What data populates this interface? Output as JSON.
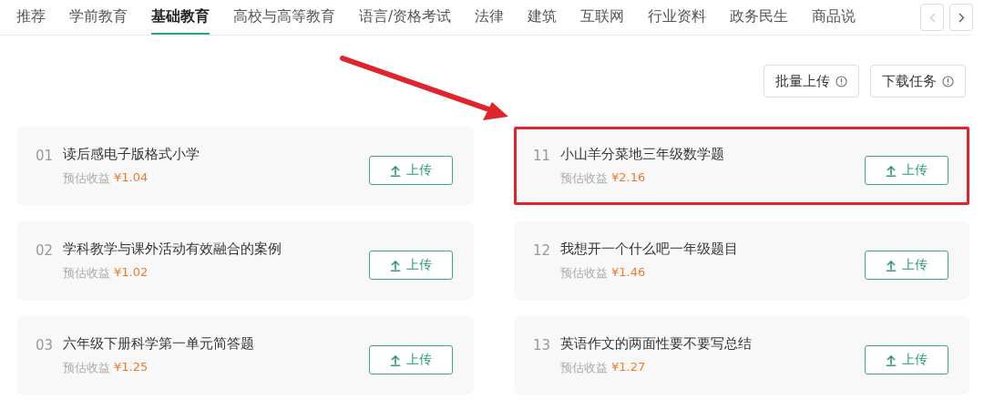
{
  "tabs": [
    {
      "label": "推荐",
      "selected": false
    },
    {
      "label": "学前教育",
      "selected": false
    },
    {
      "label": "基础教育",
      "selected": true
    },
    {
      "label": "高校与高等教育",
      "selected": false
    },
    {
      "label": "语言/资格考试",
      "selected": false
    },
    {
      "label": "法律",
      "selected": false
    },
    {
      "label": "建筑",
      "selected": false
    },
    {
      "label": "互联网",
      "selected": false
    },
    {
      "label": "行业资料",
      "selected": false
    },
    {
      "label": "政务民生",
      "selected": false
    },
    {
      "label": "商品说",
      "selected": false
    }
  ],
  "tab_scroll": {
    "prev_disabled": true,
    "next_disabled": false
  },
  "actions": [
    {
      "label": "批量上传"
    },
    {
      "label": "下载任务"
    }
  ],
  "columns": [
    [
      {
        "index": "01",
        "title": "读后感电子版格式小学",
        "income_label": "预估收益",
        "income": "¥1.04",
        "button": "上传",
        "highlighted": false
      },
      {
        "index": "02",
        "title": "学科教学与课外活动有效融合的案例",
        "income_label": "预估收益",
        "income": "¥1.02",
        "button": "上传",
        "highlighted": false
      },
      {
        "index": "03",
        "title": "六年级下册科学第一单元简答题",
        "income_label": "预估收益",
        "income": "¥1.25",
        "button": "上传",
        "highlighted": false
      }
    ],
    [
      {
        "index": "11",
        "title": "小山羊分菜地三年级数学题",
        "income_label": "预估收益",
        "income": "¥2.16",
        "button": "上传",
        "highlighted": true
      },
      {
        "index": "12",
        "title": "我想开一个什么吧一年级题目",
        "income_label": "预估收益",
        "income": "¥1.46",
        "button": "上传",
        "highlighted": false
      },
      {
        "index": "13",
        "title": "英语作文的两面性要不要写总结",
        "income_label": "预估收益",
        "income": "¥1.27",
        "button": "上传",
        "highlighted": false
      }
    ]
  ],
  "annotation_arrow": true
}
